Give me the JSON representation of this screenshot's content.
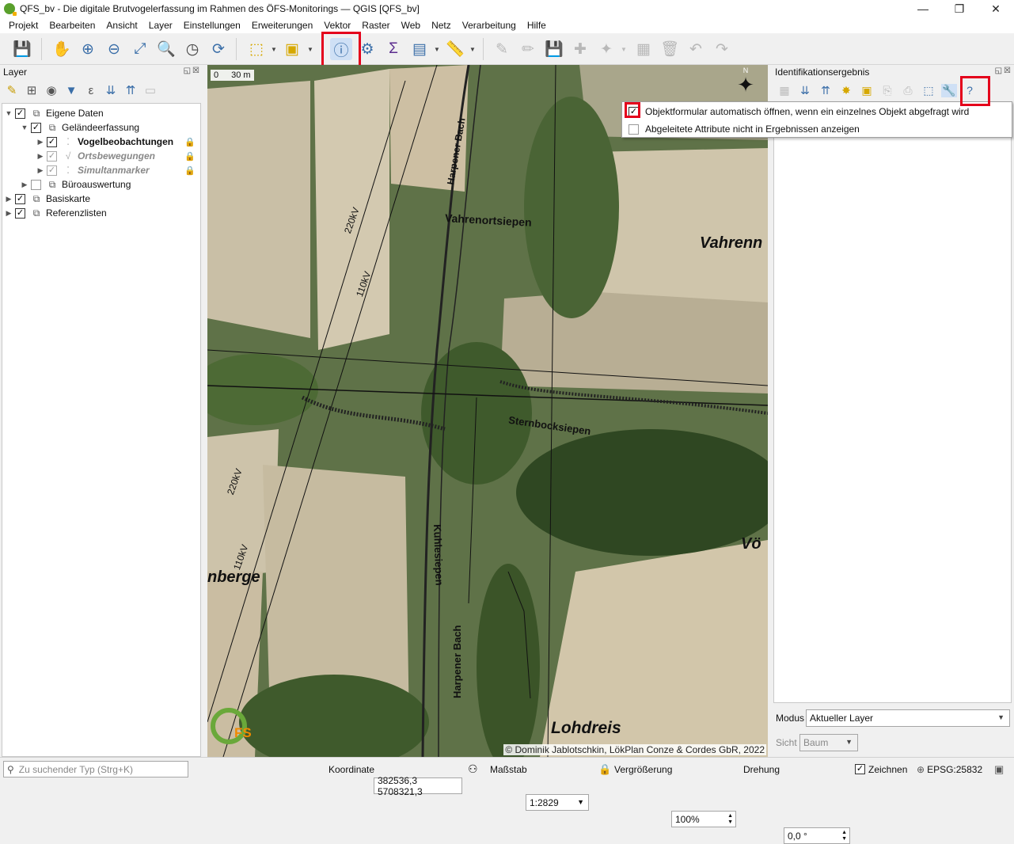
{
  "window": {
    "title": "QFS_bv - Die digitale Brutvogelerfassung im Rahmen des ÖFS-Monitorings — QGIS [QFS_bv]",
    "minimize": "—",
    "restore": "❐",
    "close": "✕"
  },
  "menu": [
    "Projekt",
    "Bearbeiten",
    "Ansicht",
    "Layer",
    "Einstellungen",
    "Erweiterungen",
    "Vektor",
    "Raster",
    "Web",
    "Netz",
    "Verarbeitung",
    "Hilfe"
  ],
  "layers_panel": {
    "title": "Layer",
    "tree": [
      {
        "label": "Eigene Daten",
        "checked": true,
        "style": "normal",
        "indent": 0,
        "expanded": true
      },
      {
        "label": "Geländeerfassung",
        "checked": true,
        "style": "normal",
        "indent": 1,
        "expanded": true
      },
      {
        "label": "Vogelbeobachtungen",
        "checked": true,
        "style": "bold",
        "indent": 2,
        "expanded": false,
        "locked": true
      },
      {
        "label": "Ortsbewegungen",
        "checked": true,
        "style": "italic",
        "indent": 2,
        "expanded": false,
        "locked": true
      },
      {
        "label": "Simultanmarker",
        "checked": true,
        "style": "italic",
        "indent": 2,
        "expanded": false,
        "locked": true
      },
      {
        "label": "Büroauswertung",
        "checked": false,
        "style": "normal",
        "indent": 1,
        "expanded": false
      },
      {
        "label": "Basiskarte",
        "checked": true,
        "style": "normal",
        "indent": 0,
        "expanded": false
      },
      {
        "label": "Referenzlisten",
        "checked": true,
        "style": "normal",
        "indent": 0,
        "expanded": false
      }
    ]
  },
  "map": {
    "scalebar": {
      "zero": "0",
      "label": "30 m"
    },
    "labels": {
      "vahrenortsiepen": "Vahrenortsiepen",
      "vahrenn": "Vahrenn",
      "sternbocksiepen": "Sternbocksiepen",
      "kuhlesiepen": "Kuhlesiepen",
      "harpener_bach_1": "Harpener Bach",
      "harpener_bach_2": "Harpener Bach",
      "lohdreis": "Lohdreis",
      "berge": "nberge",
      "voe": "Vö",
      "v220_1": "220kV",
      "v110_1": "110kV",
      "v220_2": "220kV",
      "v110_2": "110kV"
    },
    "logo": {
      "q": "Q",
      "fs": "FS"
    },
    "north": "N",
    "copyright": "© Dominik Jablotschkin, LökPlan Conze & Cordes GbR, 2022"
  },
  "identify_panel": {
    "title": "Identifikationsergebnis",
    "popup": {
      "opt1": "Objektformular automatisch öffnen, wenn ein einzelnes Objekt abgefragt wird",
      "opt1_checked": true,
      "opt2": "Abgeleitete Attribute nicht in Ergebnissen anzeigen",
      "opt2_checked": false
    },
    "mode_label": "Modus",
    "mode_value": "Aktueller Layer",
    "view_label": "Sicht",
    "view_value": "Baum"
  },
  "status": {
    "search_placeholder": "Zu suchender Typ (Strg+K)",
    "coord_label": "Koordinate",
    "coord_value": "382536,3 5708321,3",
    "scale_label": "Maßstab",
    "scale_value": "1:2829",
    "magnifier_label": "Vergrößerung",
    "magnifier_value": "100%",
    "rotation_label": "Drehung",
    "rotation_value": "0,0 °",
    "render_label": "Zeichnen",
    "crs": "EPSG:25832"
  },
  "colors": {
    "highlight": "#e4001b",
    "accent": "#3a6ea8"
  }
}
